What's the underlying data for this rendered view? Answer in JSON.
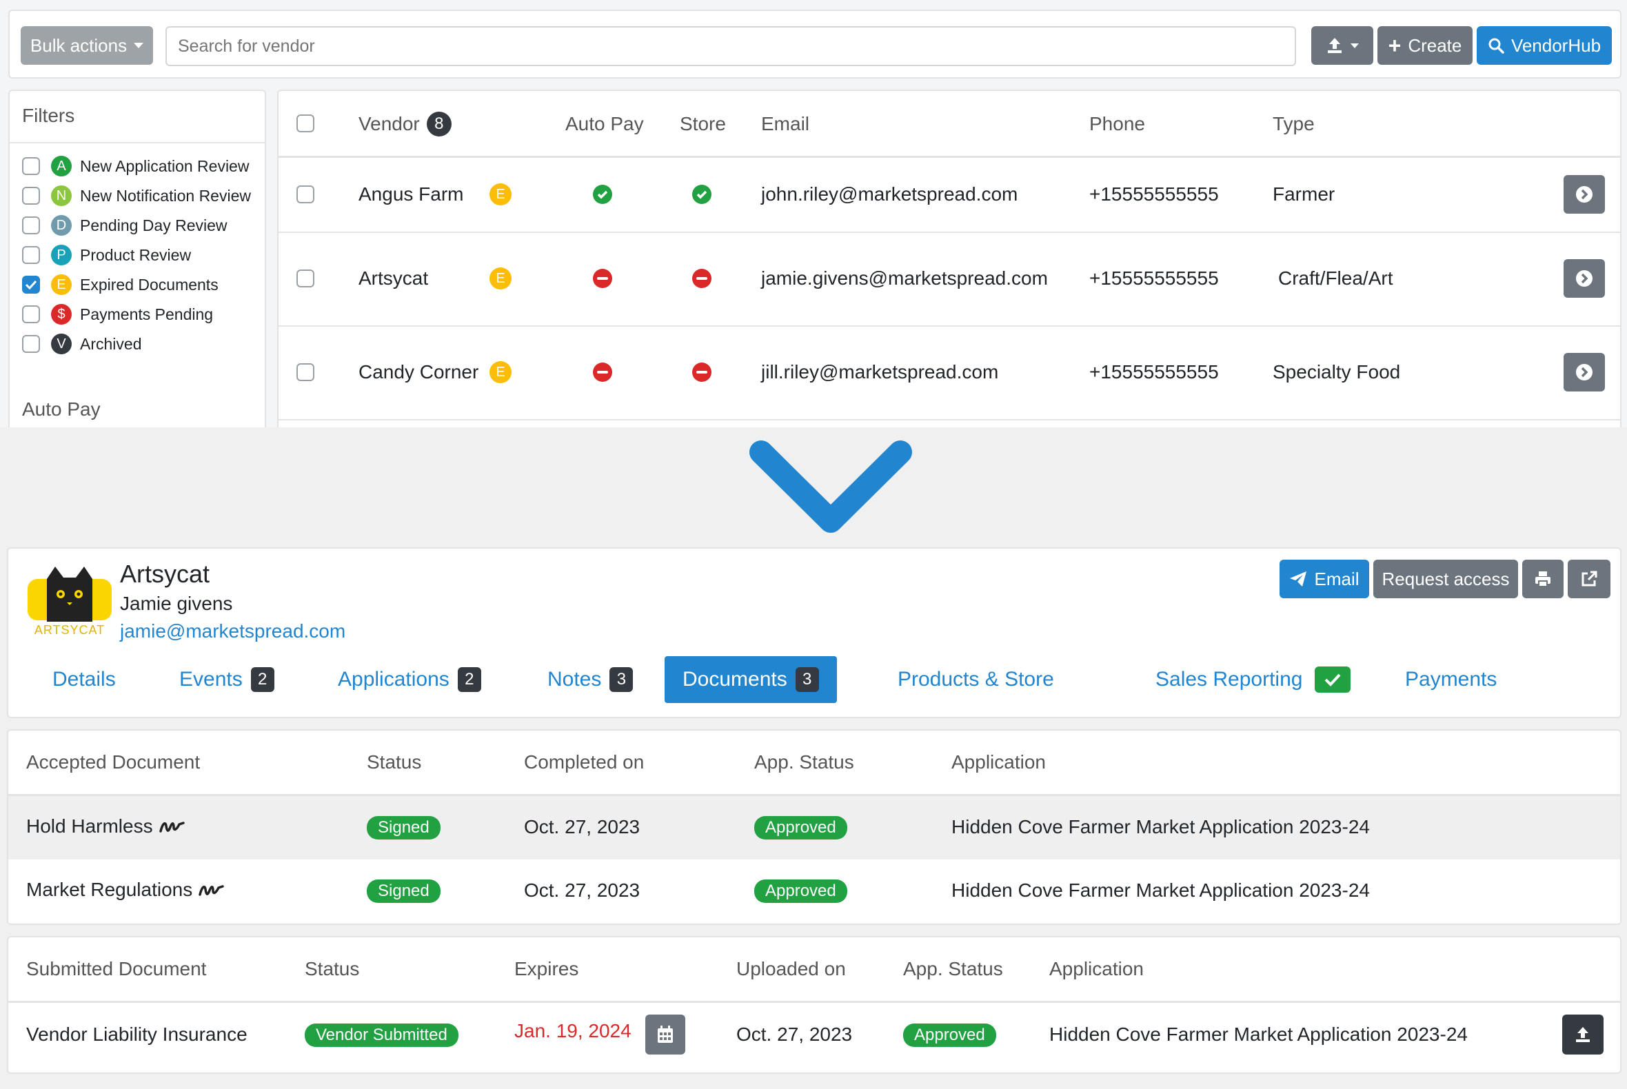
{
  "toolbar": {
    "bulk_actions": "Bulk actions",
    "search_placeholder": "Search for vendor",
    "create": "Create",
    "vendorhub": "VendorHub"
  },
  "filters": {
    "title": "Filters",
    "items": [
      {
        "letter": "A",
        "label": "New Application Review",
        "color": "#21a142",
        "checked": false
      },
      {
        "letter": "N",
        "label": "New Notification Review",
        "color": "#8cc63f",
        "checked": false
      },
      {
        "letter": "D",
        "label": "Pending Day Review",
        "color": "#6f9bad",
        "checked": false
      },
      {
        "letter": "P",
        "label": "Product Review",
        "color": "#17a2b8",
        "checked": false
      },
      {
        "letter": "E",
        "label": "Expired Documents",
        "color": "#fbbd08",
        "checked": true
      },
      {
        "letter": "$",
        "label": "Payments Pending",
        "color": "#db2828",
        "checked": false
      },
      {
        "letter": "V",
        "label": "Archived",
        "color": "#343a40",
        "checked": false
      }
    ],
    "autopay_heading": "Auto Pay"
  },
  "vendor_table": {
    "headers": {
      "vendor": "Vendor",
      "vendor_count": "8",
      "autopay": "Auto Pay",
      "store": "Store",
      "email": "Email",
      "phone": "Phone",
      "type": "Type"
    },
    "rows": [
      {
        "name": "Angus Farm",
        "badge": "E",
        "autopay": true,
        "store": true,
        "email": "john.riley@marketspread.com",
        "phone": "+15555555555",
        "type": "Farmer"
      },
      {
        "name": "Artsycat",
        "badge": "E",
        "autopay": false,
        "store": false,
        "email": "jamie.givens@marketspread.com",
        "phone": "+15555555555",
        "type": "Craft/Flea/Art"
      },
      {
        "name": "Candy Corner",
        "badge": "E",
        "autopay": false,
        "store": false,
        "email": "jill.riley@marketspread.com",
        "phone": "+15555555555",
        "type": "Specialty Food"
      }
    ]
  },
  "vendor_detail": {
    "logo_text": "ARTSYCAT",
    "name": "Artsycat",
    "contact": "Jamie givens",
    "email": "jamie@marketspread.com",
    "actions": {
      "email": "Email",
      "request_access": "Request access"
    },
    "tabs": [
      {
        "label": "Details",
        "count": ""
      },
      {
        "label": "Events",
        "count": "2"
      },
      {
        "label": "Applications",
        "count": "2"
      },
      {
        "label": "Notes",
        "count": "3"
      },
      {
        "label": "Documents",
        "count": "3"
      },
      {
        "label": "Products & Store",
        "count": ""
      },
      {
        "label": "Sales Reporting",
        "count": ""
      },
      {
        "label": "Payments",
        "count": ""
      }
    ],
    "active_tab": "Documents"
  },
  "accepted_docs": {
    "headers": {
      "document": "Accepted Document",
      "status": "Status",
      "completed": "Completed on",
      "app_status": "App. Status",
      "application": "Application"
    },
    "rows": [
      {
        "document": "Hold Harmless",
        "status": "Signed",
        "completed": "Oct. 27, 2023",
        "app_status": "Approved",
        "application": "Hidden Cove Farmer Market Application 2023-24"
      },
      {
        "document": "Market Regulations",
        "status": "Signed",
        "completed": "Oct. 27, 2023",
        "app_status": "Approved",
        "application": "Hidden Cove Farmer Market Application 2023-24"
      }
    ]
  },
  "submitted_docs": {
    "headers": {
      "document": "Submitted Document",
      "status": "Status",
      "expires": "Expires",
      "uploaded": "Uploaded on",
      "app_status": "App. Status",
      "application": "Application"
    },
    "rows": [
      {
        "document": "Vendor Liability Insurance",
        "status": "Vendor Submitted",
        "expires": "Jan. 19, 2024",
        "uploaded": "Oct. 27, 2023",
        "app_status": "Approved",
        "application": "Hidden Cove Farmer Market Application 2023-24"
      }
    ]
  },
  "colors": {
    "accent": "#2185d0",
    "success": "#21a142",
    "danger": "#db2828",
    "warning": "#fbbd08",
    "expired_date": "#db2828"
  }
}
